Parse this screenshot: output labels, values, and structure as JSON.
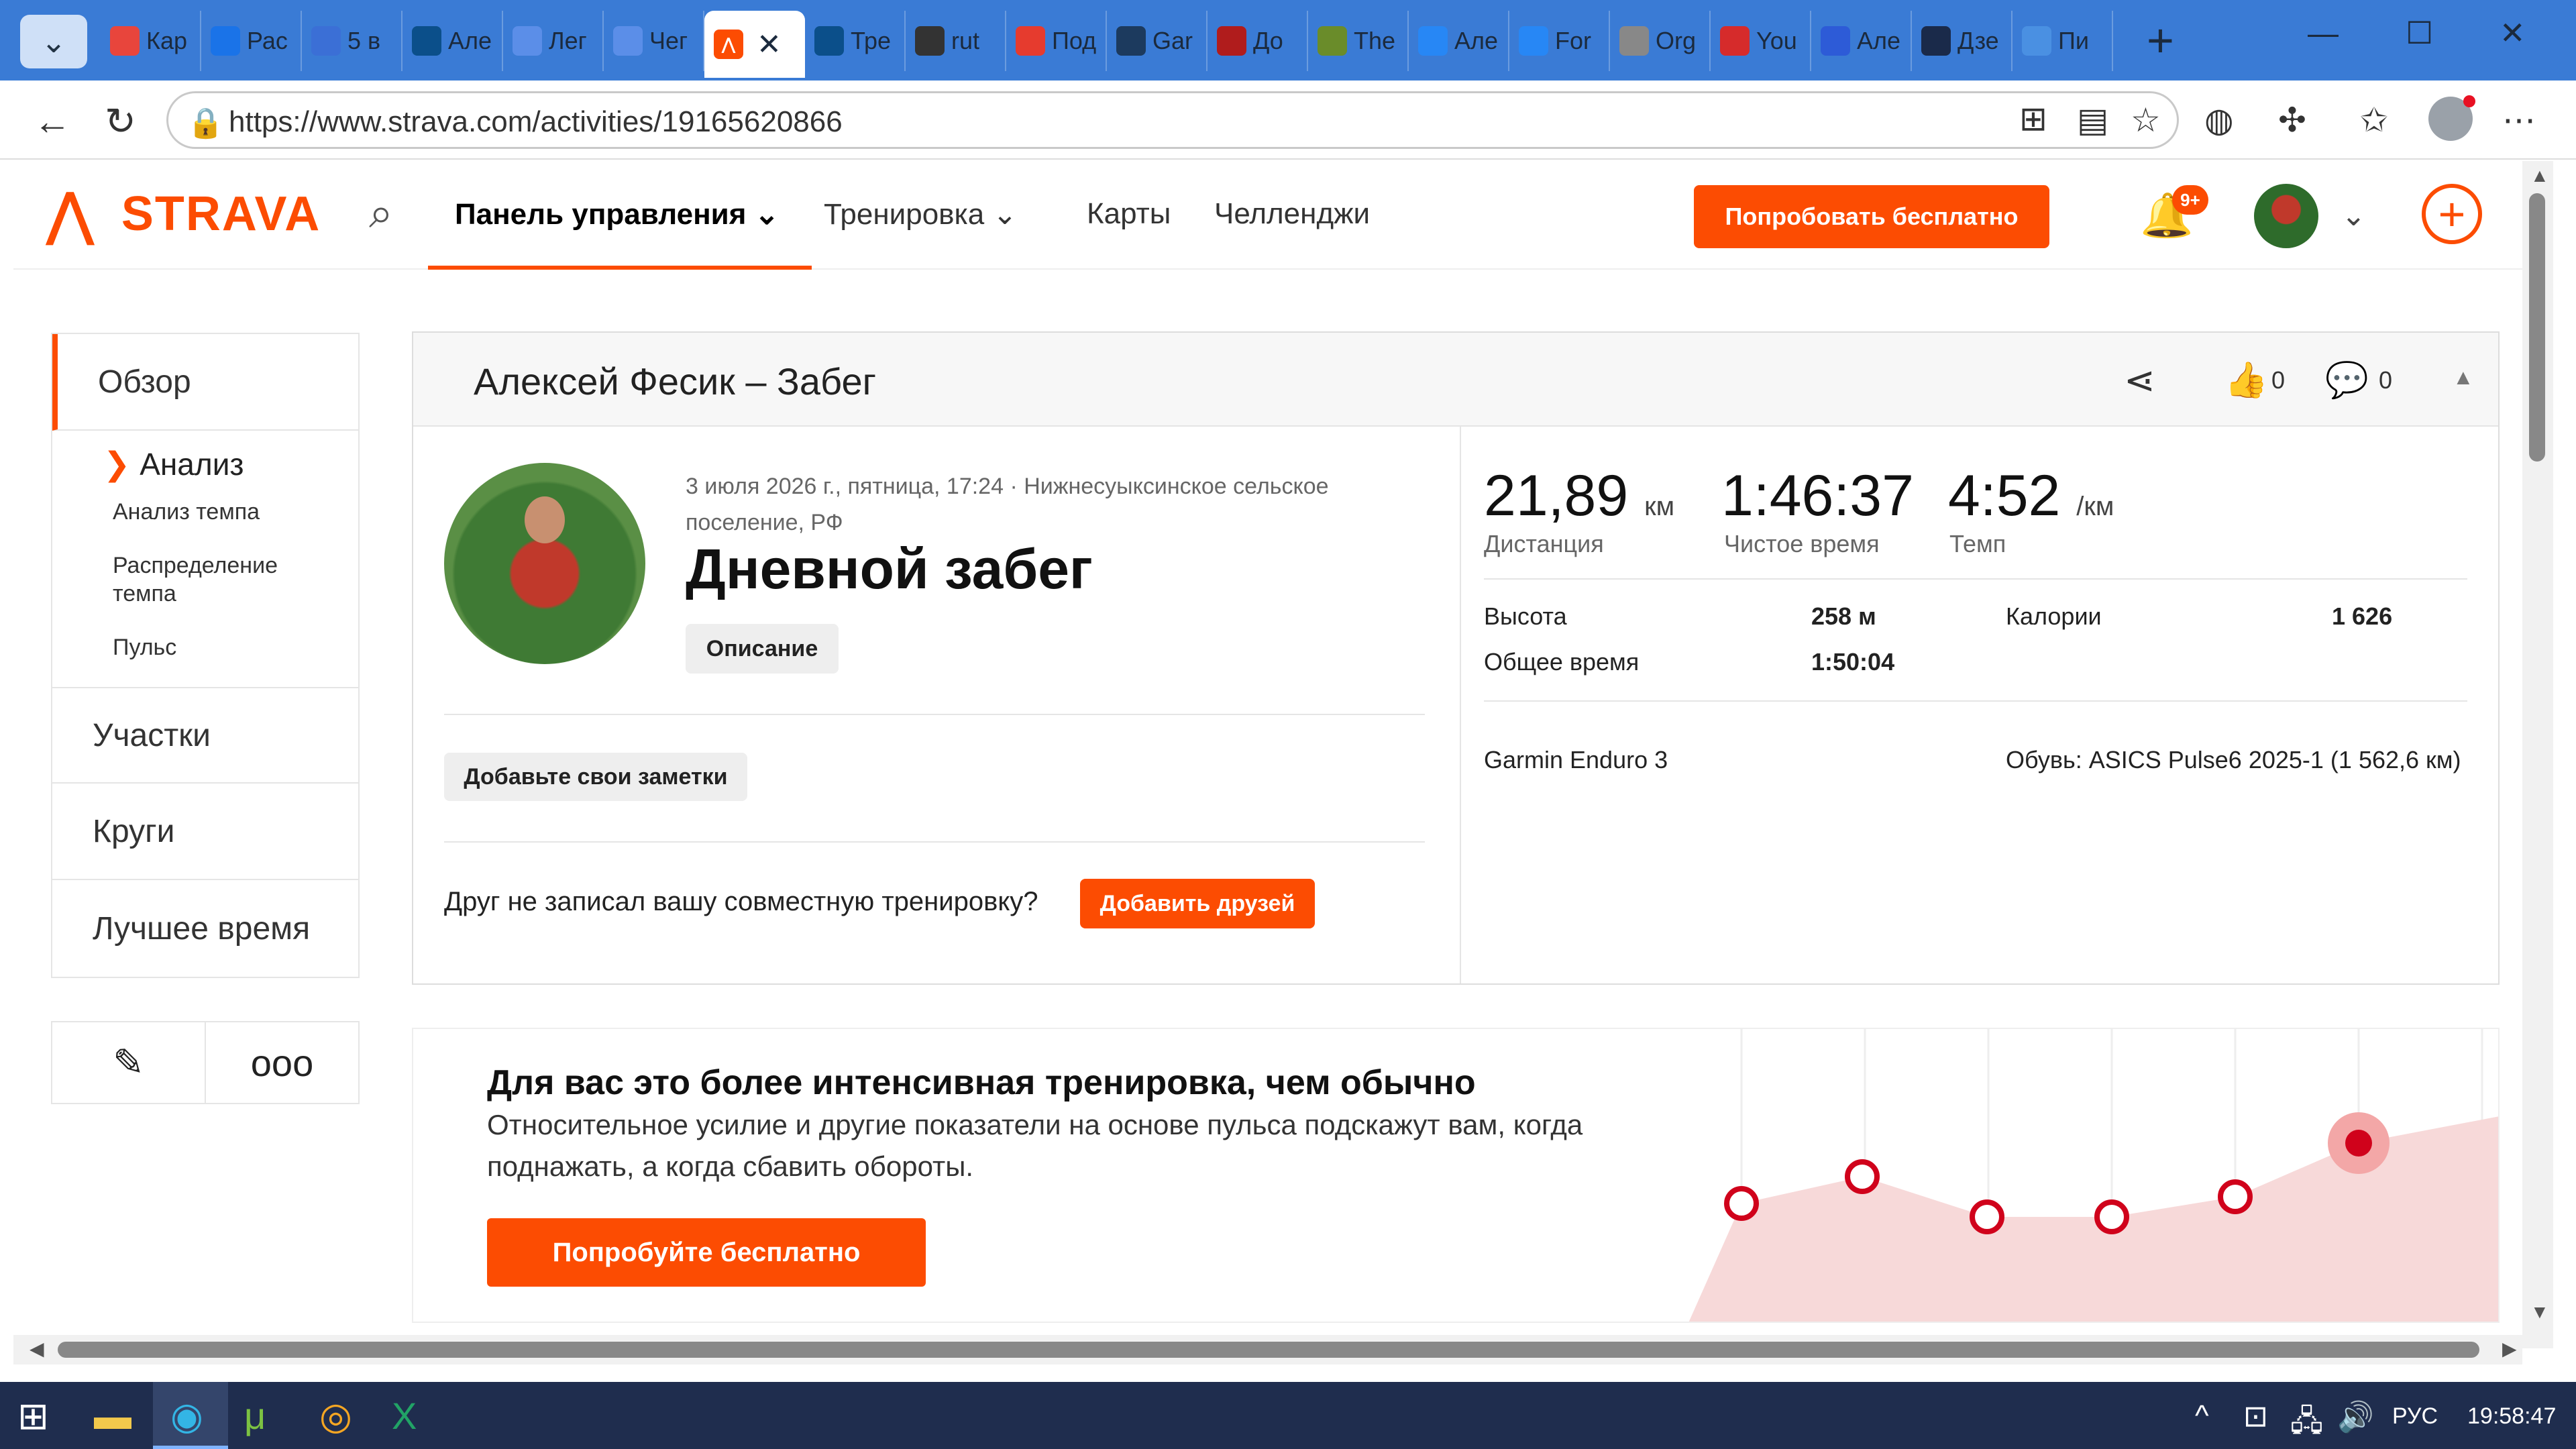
{
  "browser": {
    "tabs": [
      {
        "label": "Кар",
        "icon": "map-pin-icon",
        "color": "#e8453c"
      },
      {
        "label": "Рас",
        "icon": "mail-icon",
        "color": "#1a73e8"
      },
      {
        "label": "5 в",
        "icon": "b-circle-icon",
        "color": "#3b6fd6"
      },
      {
        "label": "Але",
        "icon": "runner-icon",
        "color": "#0b4f8a"
      },
      {
        "label": "Лег",
        "icon": "sb-icon",
        "color": "#5b8ee8"
      },
      {
        "label": "Чег",
        "icon": "sb-icon",
        "color": "#5b8ee8"
      },
      {
        "label": "",
        "icon": "strava-icon",
        "color": "#fc4c02"
      },
      {
        "label": "Тре",
        "icon": "drop-icon",
        "color": "#0b4f8a"
      },
      {
        "label": "rut",
        "icon": "link-icon",
        "color": "#333"
      },
      {
        "label": "Под",
        "icon": "umbrella-icon",
        "color": "#e63b2e"
      },
      {
        "label": "Gar",
        "icon": "garmin-icon",
        "color": "#1c3a5e"
      },
      {
        "label": "До",
        "icon": "flag-icon",
        "color": "#b01c1c"
      },
      {
        "label": "The",
        "icon": "peak-icon",
        "color": "#6a8c2a"
      },
      {
        "label": "Але",
        "icon": "vk-icon",
        "color": "#2787f5"
      },
      {
        "label": "For",
        "icon": "vk-icon",
        "color": "#2787f5"
      },
      {
        "label": "Org",
        "icon": "check-icon",
        "color": "#888"
      },
      {
        "label": "You",
        "icon": "youtube-icon",
        "color": "#d62b2b"
      },
      {
        "label": "Але",
        "icon": "r-icon",
        "color": "#2d5bd7"
      },
      {
        "label": "Дзе",
        "icon": "star-icon",
        "color": "#1a2a4a"
      },
      {
        "label": "Пи",
        "icon": "feather-icon",
        "color": "#4a90e2"
      }
    ],
    "url": "https://www.strava.com/activities/19165620866"
  },
  "header": {
    "logo": "STRAVA",
    "nav_dashboard": "Панель управления",
    "nav_training": "Тренировка",
    "nav_maps": "Карты",
    "nav_challenges": "Челленджи",
    "try_free": "Попробовать бесплатно",
    "notif_badge": "9+"
  },
  "sidebar": {
    "overview": "Обзор",
    "analysis": "Анализ",
    "sub": [
      "Анализ темпа",
      "Распределение темпа",
      "Пульс"
    ],
    "segments": "Участки",
    "laps": "Круги",
    "best_time": "Лучшее время"
  },
  "activity": {
    "title": "Алексей Фесик – Забег",
    "kudos": "0",
    "comments": "0",
    "meta": "3 июля 2026 г., пятница, 17:24 · Нижнесуыксинское сельское поселение, РФ",
    "name": "Дневной забег",
    "description_btn": "Описание",
    "notes_btn": "Добавьте свои заметки",
    "friend_question": "Друг не записал вашу совместную тренировку?",
    "add_friends_btn": "Добавить друзей"
  },
  "stats": {
    "distance": {
      "value": "21,89",
      "unit": "км",
      "label": "Дистанция"
    },
    "moving_time": {
      "value": "1:46:37",
      "label": "Чистое время"
    },
    "pace": {
      "value": "4:52",
      "unit": "/км",
      "label": "Темп"
    },
    "elevation_label": "Высота",
    "elevation": "258 м",
    "calories_label": "Калории",
    "calories": "1 626",
    "elapsed_label": "Общее время",
    "elapsed": "1:50:04",
    "device": "Garmin Enduro 3",
    "shoes": "Обувь: ASICS Pulse6 2025-1 (1 562,6 км)"
  },
  "intensity": {
    "title": "Для вас это более интенсивная тренировка, чем обычно",
    "text": "Относительное усилие и другие показатели на основе пульса подскажут вам, когда поднажать, а когда сбавить обороты.",
    "button": "Попробуйте бесплатно",
    "chart_points": [
      0.55,
      0.75,
      0.45,
      0.45,
      0.6,
      1.0
    ],
    "accent": "#d0021b"
  },
  "taskbar": {
    "lang": "РУС",
    "time": "19:58:47"
  },
  "colors": {
    "brand": "#fc4c02"
  }
}
